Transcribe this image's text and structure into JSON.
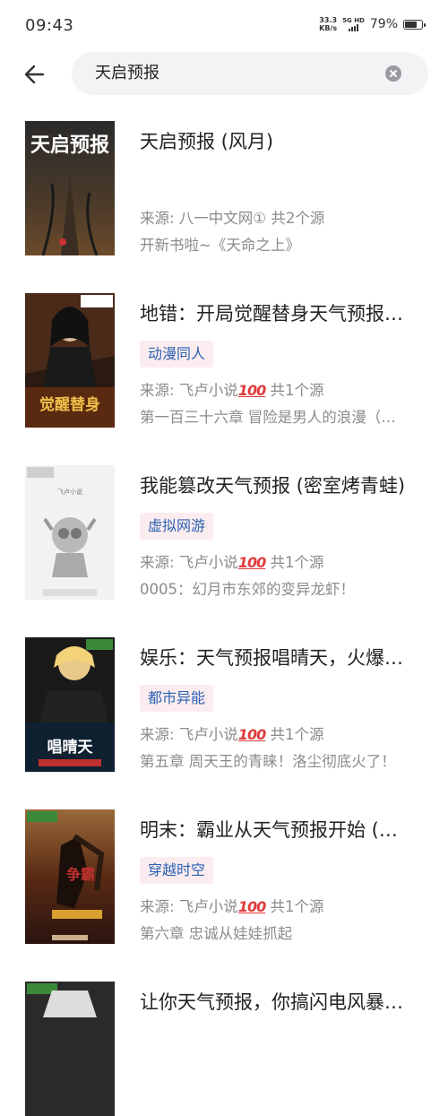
{
  "status_bar": {
    "time": "09:43",
    "net_speed_value": "33.3",
    "net_speed_unit": "KB/s",
    "signal_label": "5G HD",
    "battery_percent": "79%",
    "battery_level": 0.79
  },
  "search": {
    "query": "天启预报"
  },
  "results": [
    {
      "title": "天启预报 (风月)",
      "tag": "",
      "source": "来源: 八一中文网① 共2个源",
      "latest": "开新书啦~《天命之上》",
      "cover_text": "天启预报"
    },
    {
      "title": "地错：开局觉醒替身天气预报…",
      "tag": "动漫同人",
      "source_prefix": "来源: 飞卢小说",
      "source_badge": "100",
      "source_suffix": " 共1个源",
      "latest": "第一百三十六章 冒险是男人的浪漫（…",
      "cover_text": "觉醒替身"
    },
    {
      "title": "我能篡改天气预报 (密室烤青蛙)",
      "tag": "虚拟网游",
      "source_prefix": "来源: 飞卢小说",
      "source_badge": "100",
      "source_suffix": " 共1个源",
      "latest": "0005：幻月市东郊的变异龙虾！",
      "cover_text": "飞卢小说"
    },
    {
      "title": "娱乐：天气预报唱晴天，火爆…",
      "tag": "都市异能",
      "source_prefix": "来源: 飞卢小说",
      "source_badge": "100",
      "source_suffix": " 共1个源",
      "latest": "第五章 周天王的青睐！洛尘彻底火了！",
      "cover_text": "唱晴天"
    },
    {
      "title": "明末：霸业从天气预报开始 (…",
      "tag": "穿越时空",
      "source_prefix": "来源: 飞卢小说",
      "source_badge": "100",
      "source_suffix": " 共1个源",
      "latest": "第六章 忠诚从娃娃抓起",
      "cover_text": "争霸"
    },
    {
      "title": "让你天气预报，你搞闪电风暴…",
      "tag": "",
      "source": "",
      "latest": "",
      "cover_text": ""
    }
  ]
}
